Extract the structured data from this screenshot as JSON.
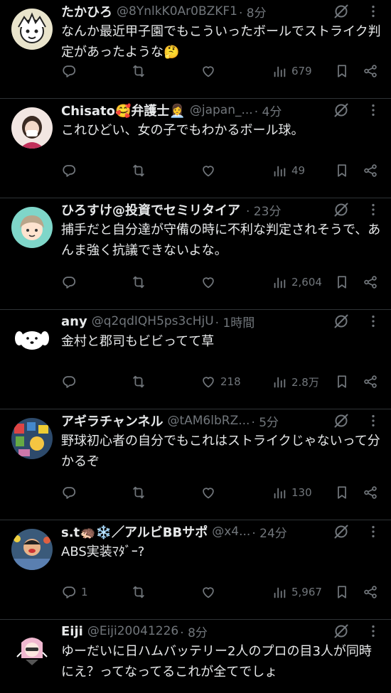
{
  "colors": {
    "background": "#000000",
    "text": "#e7e9ea",
    "muted": "#71767b",
    "divider": "#2f3336"
  },
  "tweets": [
    {
      "name": "たかひろ",
      "handle": "@8YnlkK0Ar0BZKF1",
      "time": "· 8分",
      "text": "なんか最近甲子園でもこういったボールでストライク判定があったような🤔",
      "replies": "",
      "views": "679",
      "likes": ""
    },
    {
      "name": "Chisato🥰弁護士👩‍💼",
      "handle": "@japan_...",
      "time": "· 4分",
      "text": "これひどい、女の子でもわかるボール球。",
      "replies": "",
      "views": "49",
      "likes": ""
    },
    {
      "name": "ひろすけ@投資でセミリタイア",
      "handle": "",
      "time": "· 23分",
      "text": "捕手だと自分達が守備の時に不利な判定されそうで、あんま強く抗議できないよな。",
      "replies": "",
      "views": "2,604",
      "likes": ""
    },
    {
      "name": "any",
      "handle": "@q2qdIQH5ps3cHjU",
      "time": "· 1時間",
      "text": "金村と郡司もビビってて草",
      "replies": "",
      "views": "2.8万",
      "likes": "218"
    },
    {
      "name": "アギラチャンネル",
      "handle": "@tAM6lbRZ...",
      "time": "· 5分",
      "text": "野球初心者の自分でもこれはストライクじゃないって分かるぞ",
      "replies": "",
      "views": "130",
      "likes": ""
    },
    {
      "name": "s.t🦔❄️／アルビBBサポ",
      "handle": "@x4...",
      "time": "· 24分",
      "text": "ABS実装ﾏﾀﾞｰ?",
      "replies": "1",
      "views": "5,967",
      "likes": ""
    },
    {
      "name": "Eiji",
      "handle": "@Eiji20041226",
      "time": "· 8分",
      "text": "ゆーだいに日ハムバッテリー2人のプロの目3人が同時にえ？ってなってるこれが全てでしょ",
      "replies": "",
      "views": "",
      "likes": ""
    }
  ]
}
